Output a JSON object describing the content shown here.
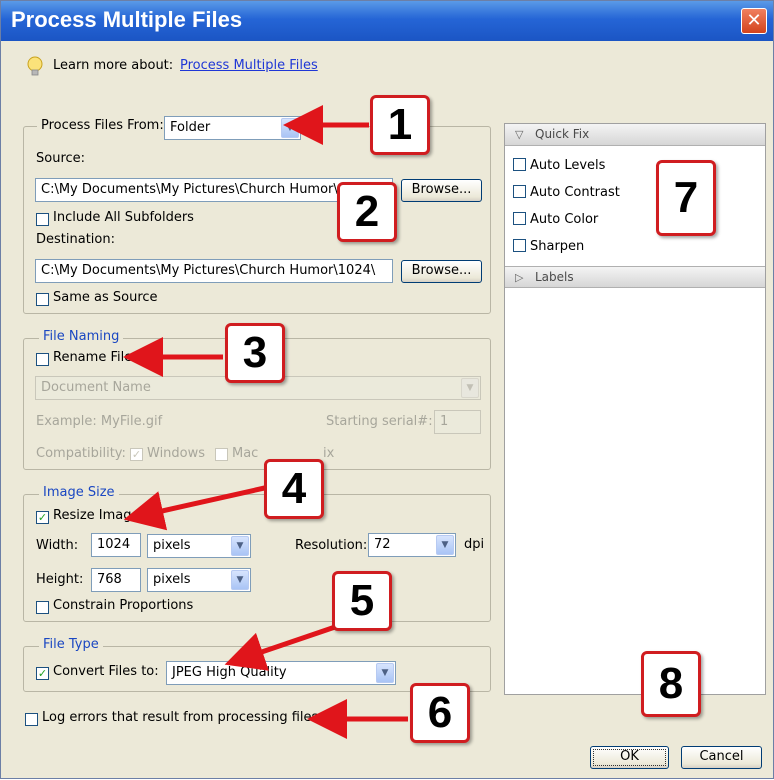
{
  "window": {
    "title": "Process Multiple Files",
    "close_glyph": "✕"
  },
  "learn": {
    "label": "Learn more about:",
    "link": "Process Multiple Files"
  },
  "source_group": {
    "process_from_label": "Process Files From:",
    "process_from_value": "Folder",
    "source_label": "Source:",
    "source_path": "C:\\My Documents\\My Pictures\\Church Humor\\",
    "browse": "Browse...",
    "include_subfolders": "Include All Subfolders",
    "destination_label": "Destination:",
    "destination_path": "C:\\My Documents\\My Pictures\\Church Humor\\1024\\",
    "same_as_source": "Same as Source"
  },
  "file_naming": {
    "legend": "File Naming",
    "rename": "Rename Files",
    "name_value": "Document Name",
    "example": "Example: MyFile.gif",
    "starting_serial_label": "Starting serial#:",
    "starting_serial_value": "1",
    "compat_label": "Compatibility:",
    "windows": "Windows",
    "mac": "Mac",
    "unix": "ix"
  },
  "image_size": {
    "legend": "Image Size",
    "resize": "Resize Images",
    "width_label": "Width:",
    "width_value": "1024",
    "width_unit": "pixels",
    "height_label": "Height:",
    "height_value": "768",
    "height_unit": "pixels",
    "resolution_label": "Resolution:",
    "resolution_value": "72",
    "dpi": "dpi",
    "constrain": "Constrain Proportions"
  },
  "file_type": {
    "legend": "File Type",
    "convert": "Convert Files to:",
    "format": "JPEG High Quality"
  },
  "log_errors": "Log errors that result from processing files",
  "quick_fix": {
    "header": "Quick Fix",
    "items": [
      "Auto Levels",
      "Auto Contrast",
      "Auto Color",
      "Sharpen"
    ],
    "labels_header": "Labels"
  },
  "buttons": {
    "ok": "OK",
    "cancel": "Cancel"
  },
  "markers": [
    "1",
    "2",
    "3",
    "4",
    "5",
    "6",
    "7",
    "8"
  ],
  "colors": {
    "title_bar": "#2565d6",
    "legend_text": "#1a47c2",
    "marker_border": "#d01d20",
    "arrow": "#e0151b"
  }
}
